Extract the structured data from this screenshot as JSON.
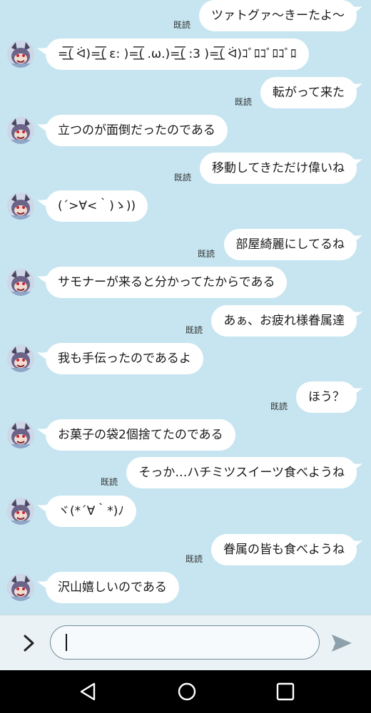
{
  "conversation": {
    "read_label": "既読",
    "messages": [
      {
        "side": "out",
        "text": "ツァトグァ〜きーたよ〜",
        "read": true
      },
      {
        "side": "in",
        "text": "=͟͟͞͞( ᐛ)=͟͟͞͞( ε: )=͟͟͞͞( .ω.)=͟͟͞͞( :3 )=͟͟͞͞( ᐛ)ｺﾞﾛｺﾞﾛｺﾞﾛ"
      },
      {
        "side": "out",
        "text": "転がって来た",
        "read": true
      },
      {
        "side": "in",
        "text": "立つのが面倒だったのである"
      },
      {
        "side": "out",
        "text": "移動してきただけ偉いね",
        "read": true
      },
      {
        "side": "in",
        "text": "(´>∀<｀)ゝ))"
      },
      {
        "side": "out",
        "text": "部屋綺麗にしてるね",
        "read": true
      },
      {
        "side": "in",
        "text": "サモナーが来ると分かってたからである"
      },
      {
        "side": "out",
        "text": "あぁ、お疲れ様眷属達",
        "read": true
      },
      {
        "side": "in",
        "text": "我も手伝ったのであるよ"
      },
      {
        "side": "out",
        "text": "ほう？",
        "read": true
      },
      {
        "side": "in",
        "text": "お菓子の袋2個捨てたのである"
      },
      {
        "side": "out",
        "text": "そっか…ハチミツスイーツ食べようね",
        "read": true
      },
      {
        "side": "in",
        "text": "ヾ(*´∀｀*)ﾉ"
      },
      {
        "side": "out",
        "text": "眷属の皆も食べようね",
        "read": true
      },
      {
        "side": "in",
        "text": "沢山嬉しいのである"
      }
    ]
  },
  "composer": {
    "input_value": "",
    "expand_icon": "chevron-right-icon",
    "send_icon": "send-icon"
  },
  "navbar": {
    "back_icon": "back-triangle-icon",
    "home_icon": "home-circle-icon",
    "recents_icon": "recents-square-icon"
  },
  "colors": {
    "chat_background": "#c6e5f0",
    "bubble": "#ffffff",
    "navbar": "#000000"
  }
}
